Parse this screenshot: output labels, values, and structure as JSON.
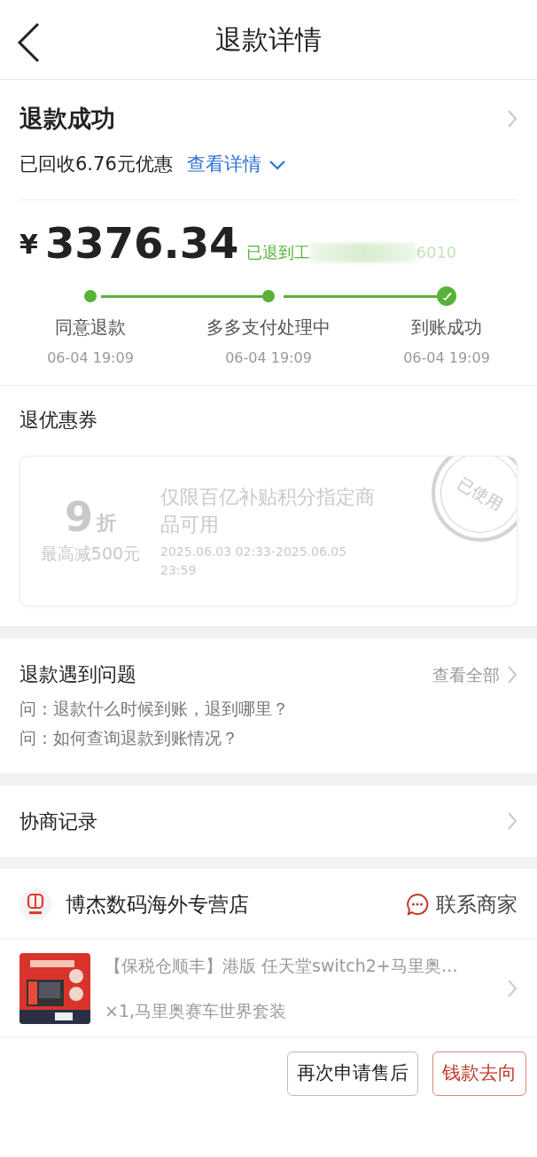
{
  "header": {
    "title": "退款详情"
  },
  "status": {
    "title": "退款成功",
    "recovered": "已回收6.76元优惠",
    "details_link": "查看详情"
  },
  "refund": {
    "currency": "¥",
    "amount": "3376.34",
    "destination": "已退到工",
    "account_tail": "6010",
    "steps": [
      {
        "label": "同意退款",
        "time": "06-04 19:09",
        "done": true,
        "final": false
      },
      {
        "label": "多多支付处理中",
        "time": "06-04 19:09",
        "done": true,
        "final": false
      },
      {
        "label": "到账成功",
        "time": "06-04 19:09",
        "done": true,
        "final": true
      }
    ]
  },
  "coupon_section": {
    "title": "退优惠券",
    "coupon": {
      "value": "9",
      "unit": "折",
      "limit": "最高减500元",
      "description": "仅限百亿补贴积分指定商品可用",
      "validity": "2025.06.03 02:33-2025.06.05 23:59",
      "stamp": "已使用",
      "used": true
    }
  },
  "issues": {
    "title": "退款遇到问题",
    "view_all": "查看全部",
    "questions": [
      "问：退款什么时候到账，退到哪里？",
      "问：如何查询退款到账情况？"
    ]
  },
  "negotiation": {
    "title": "协商记录"
  },
  "store": {
    "name": "博杰数码海外专营店",
    "contact": "联系商家"
  },
  "product": {
    "title": "【保税仓顺丰】港版 任天堂switch2+马里奥…",
    "spec": "×1,马里奥赛车世界套装"
  },
  "buttons": [
    {
      "label": "再次申请售后",
      "kind": "plain"
    },
    {
      "label": "钱款去向",
      "kind": "accent"
    }
  ]
}
